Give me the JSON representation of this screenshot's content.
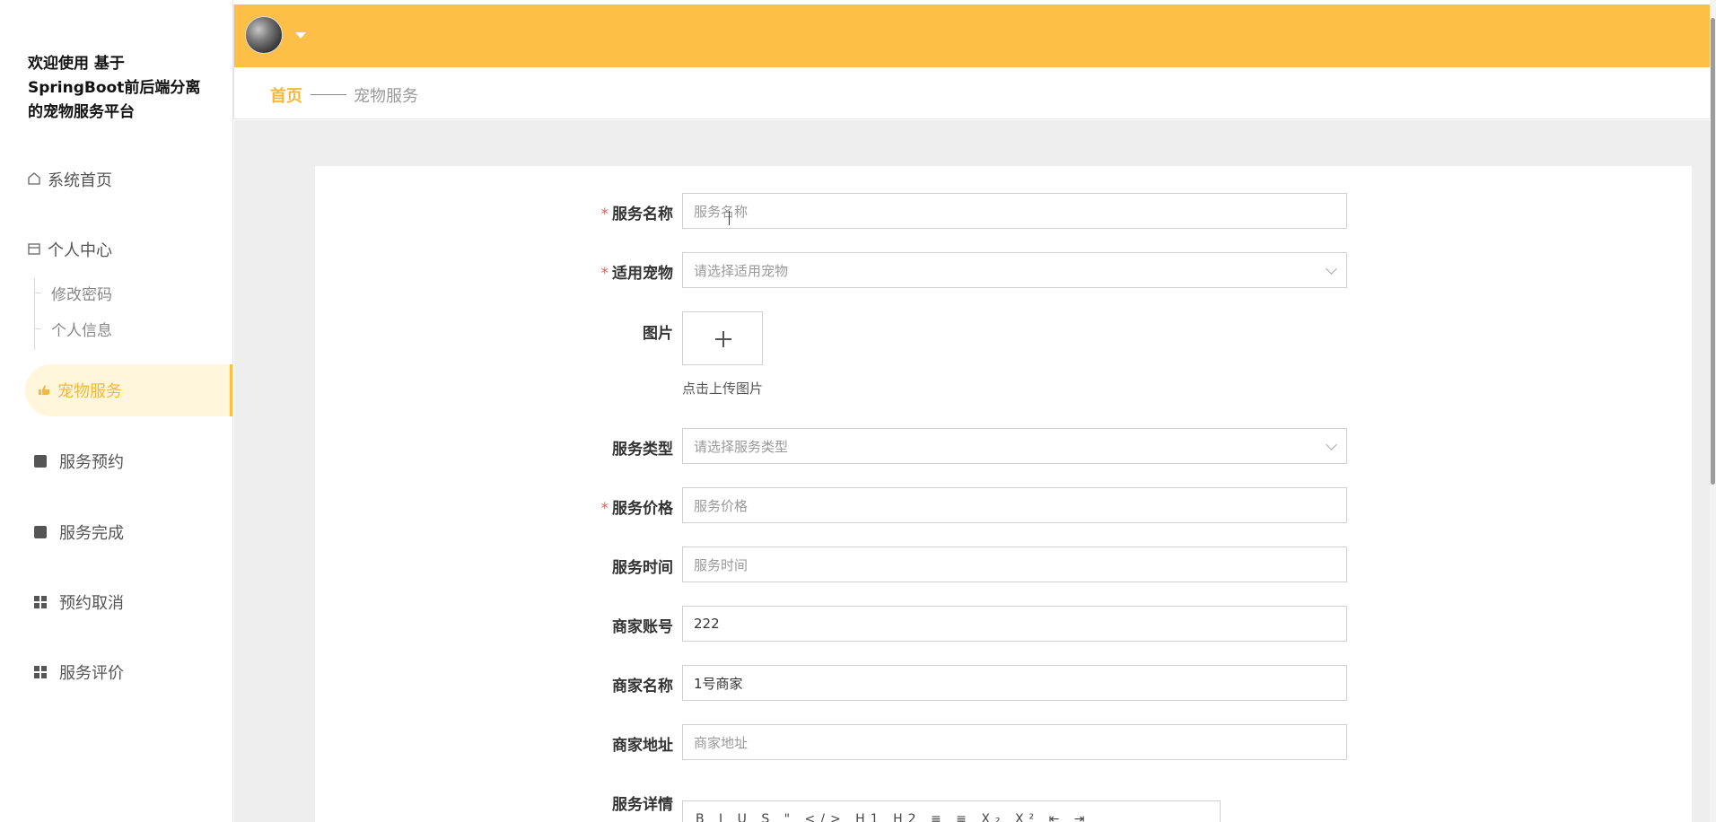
{
  "brand": {
    "line1": "欢迎使用 基于",
    "line2": "SpringBoot前后端分离",
    "line3": "的宠物服务平台"
  },
  "sidebar": {
    "home": "系统首页",
    "personal": "个人中心",
    "personal_sub": [
      "修改密码",
      "个人信息"
    ],
    "items": [
      "宠物服务",
      "服务预约",
      "服务完成",
      "预约取消",
      "服务评价"
    ],
    "active": "宠物服务"
  },
  "breadcrumb": {
    "home": "首页",
    "current": "宠物服务"
  },
  "form": {
    "service_name": {
      "label": "服务名称",
      "required": true,
      "placeholder": "服务名称",
      "value": ""
    },
    "pet": {
      "label": "适用宠物",
      "required": true,
      "placeholder": "请选择适用宠物"
    },
    "image": {
      "label": "图片",
      "hint": "点击上传图片"
    },
    "service_type": {
      "label": "服务类型",
      "placeholder": "请选择服务类型"
    },
    "price": {
      "label": "服务价格",
      "required": true,
      "placeholder": "服务价格"
    },
    "time": {
      "label": "服务时间",
      "placeholder": "服务时间"
    },
    "merchant_account": {
      "label": "商家账号",
      "value": "222"
    },
    "merchant_name": {
      "label": "商家名称",
      "value": "1号商家"
    },
    "merchant_address": {
      "label": "商家地址",
      "placeholder": "商家地址"
    },
    "details": {
      "label": "服务详情",
      "toolbar": "B I U S \" </> H1 H2 ≡ ≡ X₂ X² ⇤ ⇥"
    }
  },
  "required_mark": "*",
  "colors": {
    "accent": "#fdbf45",
    "active_text": "#f5b83d",
    "required": "#e85c5c"
  },
  "icons": {
    "home": "home-icon",
    "personal": "calendar-icon",
    "pet_service": "hand-icon",
    "booking": "clipboard-icon",
    "done": "chat-icon",
    "cancel": "grid-icon",
    "review": "grid-icon",
    "user_caret": "caret-down-icon"
  }
}
